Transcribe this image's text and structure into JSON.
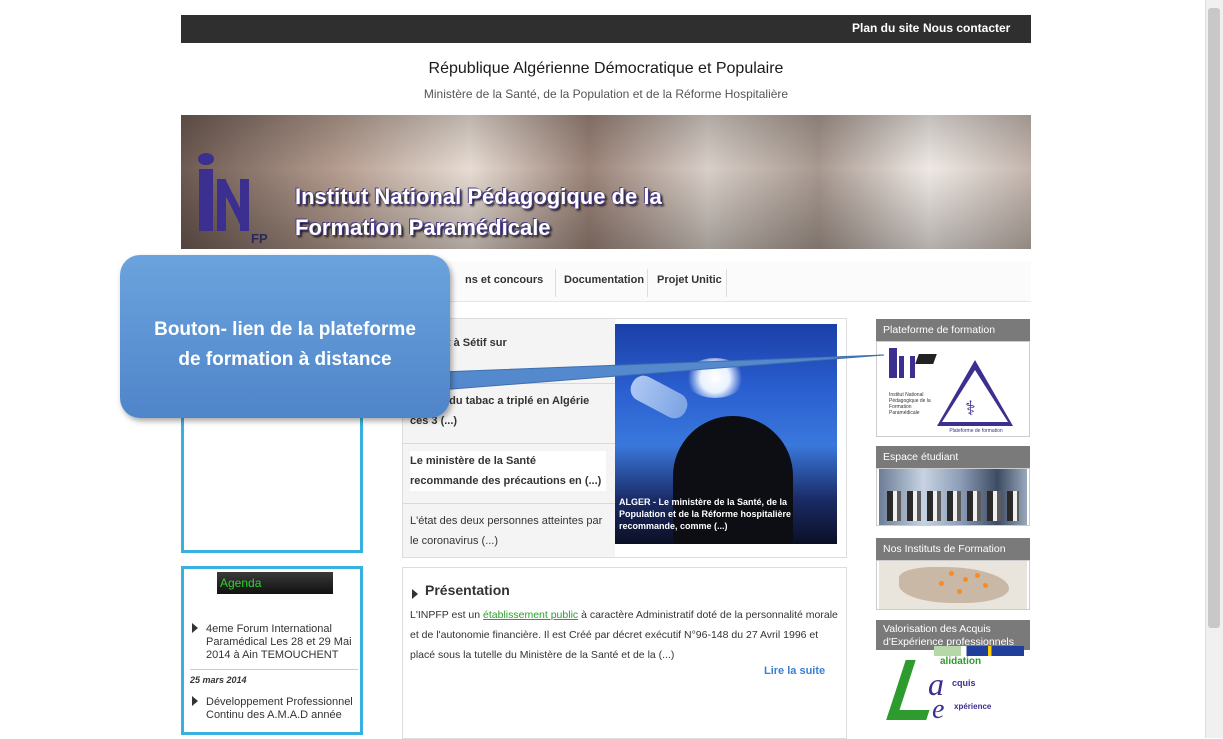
{
  "topbar": {
    "sitemap": "Plan du site",
    "contact": "Nous contacter"
  },
  "header": {
    "title": "République Algérienne Démocratique et Populaire",
    "subtitle": "Ministère de la Santé, de la Population et de la Réforme Hospitalière"
  },
  "banner": {
    "logo_fp": "FP",
    "title_line1": "Institut National Pédagogique de la",
    "title_line2": "Formation Paramédicale"
  },
  "nav": {
    "items": [
      "ns et concours",
      "Documentation",
      "Projet Unitic"
    ]
  },
  "callout": {
    "line1": "Bouton- lien de la plateforme",
    "line2": "de formation à distance"
  },
  "agenda": {
    "label": "Agenda",
    "item1": "4eme Forum International Paramédical Les 28 et 29 Mai 2014 à Ain TEMOUCHENT",
    "date": "25 mars 2014",
    "item2": "Développement Professionnel Continu des A.M.A.D année"
  },
  "news": {
    "items": [
      "l'accent à Sétif sur",
      "mation du tabac a triplé en Algérie ces 3 (...)",
      "Le ministère de la Santé recommande des précautions en (...)",
      "L'état des deux personnes atteintes par le coronavirus (...)"
    ],
    "photo_caption": "ALGER - Le ministère de la Santé, de la Population et de la Réforme hospitalière recommande, comme (...)"
  },
  "presentation": {
    "title": "Présentation",
    "text_before": "L'INPFP est un ",
    "link": "établissement public",
    "text_after": " à caractère Administratif doté de la personnalité morale et de l'autonomie financière. Il est Créé par décret exécutif N°96-148 du 27 Avril 1996 et placé sous la tutelle du Ministère de la Santé et de la (...)",
    "more": "Lire la suite"
  },
  "sidebar": {
    "platform": "Plateforme de formation",
    "students": "Espace étudiant",
    "institutes": "Nos Instituts de Formation",
    "vae_line1": "Valorisation des Acquis",
    "vae_line2": "d'Expérience professionnels",
    "vae_word1": "alidation",
    "vae_word2": "cquis",
    "vae_word3": "xpérience",
    "logo_caption": "Institut National Pédagogique de la Formation Paramédicale",
    "tri_caption": "Plateforme de formation"
  }
}
